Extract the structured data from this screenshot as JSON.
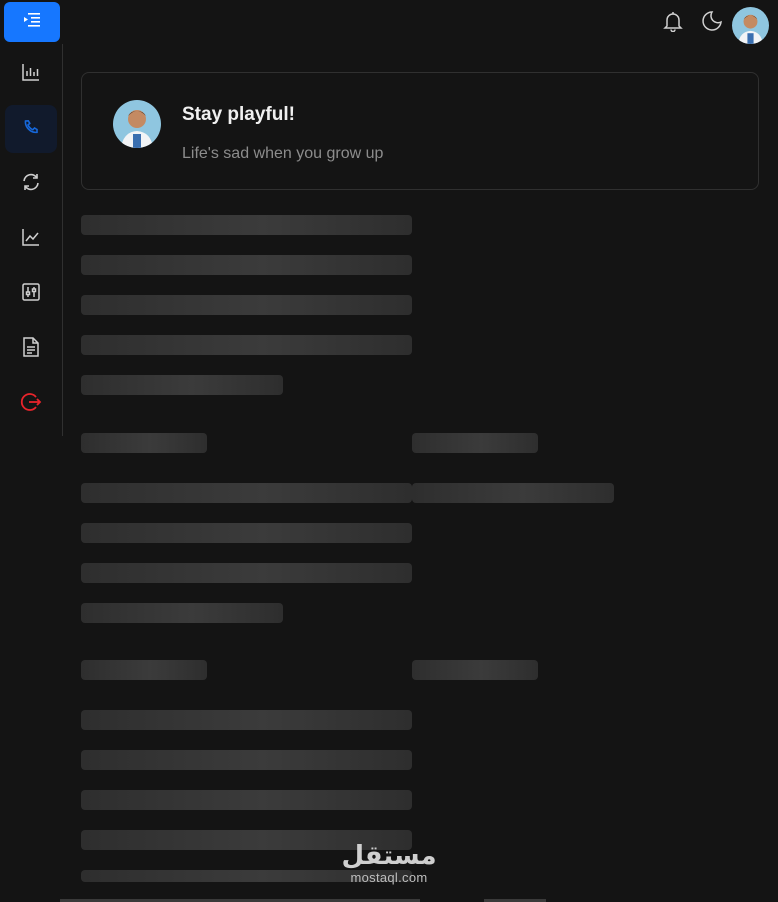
{
  "header": {
    "menu_icon": "menu-indent-icon",
    "notification_icon": "bell-icon",
    "theme_icon": "moon-icon",
    "avatar_alt": "user-avatar"
  },
  "sidebar": {
    "items": [
      {
        "name": "bar-chart-icon",
        "active": false
      },
      {
        "name": "phone-icon",
        "active": true
      },
      {
        "name": "sync-icon",
        "active": false
      },
      {
        "name": "line-chart-icon",
        "active": false
      },
      {
        "name": "sliders-icon",
        "active": false
      },
      {
        "name": "document-icon",
        "active": false
      },
      {
        "name": "logout-icon",
        "active": false
      }
    ]
  },
  "profile_card": {
    "title": "Stay playful!",
    "description": "Life's sad when you grow up"
  },
  "watermark": {
    "arabic": "مستقل",
    "domain": "mostaql.com"
  },
  "colors": {
    "accent": "#1677ff",
    "background": "#141414",
    "logout": "#e8242b",
    "skeleton": "#333333"
  }
}
